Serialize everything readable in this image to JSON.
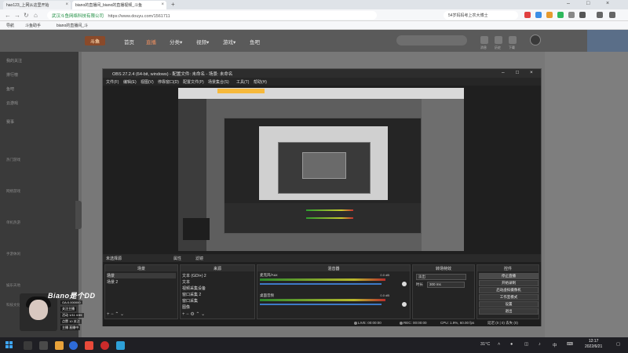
{
  "browser": {
    "tabs": [
      {
        "label": "hao123_上网从这里开始"
      },
      {
        "label": "biano的直播间_biano的直播视频_斗鱼"
      }
    ],
    "new_tab": "+",
    "url_site": "武汉斗鱼网络科技有限公司",
    "url": "https://www.douyu.com/1561711",
    "search_text": "54岁妈妈考上农大博士",
    "bookmarks": [
      {
        "label": "导航"
      },
      {
        "label": "斗鱼助手"
      },
      {
        "label": "biano的直播间_斗"
      }
    ]
  },
  "douyu": {
    "logo": "斗鱼",
    "nav": [
      {
        "label": "首页",
        "active": false
      },
      {
        "label": "直播",
        "active": true
      },
      {
        "label": "分类▾",
        "active": false
      },
      {
        "label": "视频▾",
        "active": false
      },
      {
        "label": "游戏▾",
        "active": false
      },
      {
        "label": "鱼吧",
        "active": false
      }
    ],
    "header_labels": [
      "消息",
      "历史",
      "下载",
      "开播"
    ],
    "sidebar": [
      {
        "label": "我的关注"
      },
      {
        "label": "排行榜"
      },
      {
        "label": "鱼吧"
      },
      {
        "label": "云游戏"
      },
      {
        "label": "赛事"
      }
    ],
    "sidebar_sub": [
      "热门游戏",
      "网络游戏",
      "单机热游",
      "手游休闲",
      "娱乐天地",
      "科技文化"
    ]
  },
  "cam": {
    "title": "Biano是个DD",
    "lines": [
      "OA:0.000000",
      "关注主播",
      "活动 1/11 4:55",
      "点赞 10 关注",
      "主播 直播中"
    ]
  },
  "obs": {
    "title": "OBS 27.2.4 (64-bit, windows) - 配置文件: 未命名 - 场景: 未命名",
    "menu": [
      "文件(F)",
      "编辑(E)",
      "视图(V)",
      "停靠窗口(D)",
      "配置文件(P)",
      "场景集合(S)",
      "工具(T)",
      "帮助(H)"
    ],
    "scene_header": "未选择源",
    "scene_header_controls": [
      "属性",
      "滤镜"
    ],
    "docks": {
      "scenes": {
        "title": "场景",
        "items": [
          "场景",
          "场景 2"
        ]
      },
      "sources": {
        "title": "来源",
        "items": [
          "文本 (GDI+) 2",
          "文本",
          "视频采集设备",
          "窗口采集 2",
          "窗口采集",
          "图像"
        ]
      },
      "mixer": {
        "title": "混音器",
        "channels": [
          {
            "name": "麦克风/Aux",
            "db": "0.0 dB"
          },
          {
            "name": "桌面音频",
            "db": "0.0 dB"
          }
        ]
      },
      "transitions": {
        "title": "转场特效",
        "type": "淡出",
        "duration_label": "时长",
        "duration": "300 ms"
      },
      "controls": {
        "title": "控件",
        "buttons": [
          "停止直播",
          "开始录制",
          "启动虚拟摄像机",
          "工作室模式",
          "设置",
          "退出"
        ]
      }
    },
    "status": {
      "live": "LIVE: 00:00:00",
      "rec": "REC: 00:00:00",
      "cpu": "CPU: 1.9%, 60.00 fps",
      "network": "延迟 (0 | 0) 丢失 (0)"
    }
  },
  "taskbar": {
    "weather": "31°C",
    "time": "12:17",
    "date": "2022/6/21"
  }
}
